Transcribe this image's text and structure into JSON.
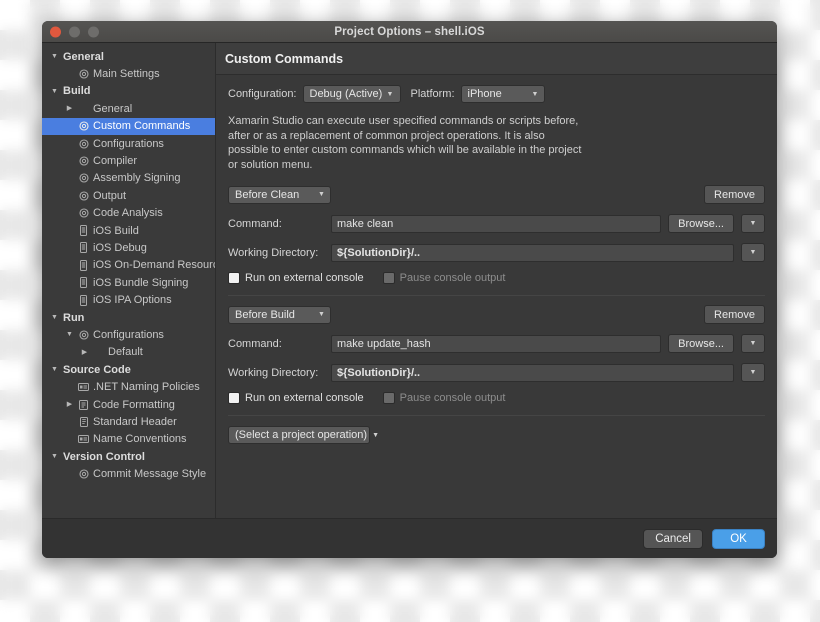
{
  "window": {
    "title": "Project Options – shell.iOS",
    "traffic_lights": [
      "close-button",
      "minimize-button",
      "zoom-button"
    ]
  },
  "sidebar": {
    "items": [
      {
        "label": "General",
        "level": 0,
        "type": "group",
        "disclosure": "down",
        "icon": "none",
        "selected": false
      },
      {
        "label": "Main Settings",
        "level": 1,
        "type": "item",
        "disclosure": "none",
        "icon": "gear",
        "selected": false
      },
      {
        "label": "Build",
        "level": 0,
        "type": "group",
        "disclosure": "down",
        "icon": "none",
        "selected": false
      },
      {
        "label": "General",
        "level": 1,
        "type": "item",
        "disclosure": "right",
        "icon": "none",
        "selected": false
      },
      {
        "label": "Custom Commands",
        "level": 1,
        "type": "item",
        "disclosure": "none",
        "icon": "gear",
        "selected": true
      },
      {
        "label": "Configurations",
        "level": 1,
        "type": "item",
        "disclosure": "none",
        "icon": "gear",
        "selected": false
      },
      {
        "label": "Compiler",
        "level": 1,
        "type": "item",
        "disclosure": "none",
        "icon": "gear",
        "selected": false
      },
      {
        "label": "Assembly Signing",
        "level": 1,
        "type": "item",
        "disclosure": "none",
        "icon": "gear",
        "selected": false
      },
      {
        "label": "Output",
        "level": 1,
        "type": "item",
        "disclosure": "none",
        "icon": "gear",
        "selected": false
      },
      {
        "label": "Code Analysis",
        "level": 1,
        "type": "item",
        "disclosure": "none",
        "icon": "gear",
        "selected": false
      },
      {
        "label": "iOS Build",
        "level": 1,
        "type": "item",
        "disclosure": "none",
        "icon": "device",
        "selected": false
      },
      {
        "label": "iOS Debug",
        "level": 1,
        "type": "item",
        "disclosure": "none",
        "icon": "device",
        "selected": false
      },
      {
        "label": "iOS On-Demand Resources",
        "level": 1,
        "type": "item",
        "disclosure": "none",
        "icon": "device",
        "selected": false
      },
      {
        "label": "iOS Bundle Signing",
        "level": 1,
        "type": "item",
        "disclosure": "none",
        "icon": "device",
        "selected": false
      },
      {
        "label": "iOS IPA Options",
        "level": 1,
        "type": "item",
        "disclosure": "none",
        "icon": "device",
        "selected": false
      },
      {
        "label": "Run",
        "level": 0,
        "type": "group",
        "disclosure": "down",
        "icon": "none",
        "selected": false
      },
      {
        "label": "Configurations",
        "level": 1,
        "type": "item",
        "disclosure": "down",
        "icon": "gear",
        "selected": false
      },
      {
        "label": "Default",
        "level": 2,
        "type": "item",
        "disclosure": "right-solid",
        "icon": "none",
        "selected": false
      },
      {
        "label": "Source Code",
        "level": 0,
        "type": "group",
        "disclosure": "down",
        "icon": "none",
        "selected": false
      },
      {
        "label": ".NET Naming Policies",
        "level": 1,
        "type": "item",
        "disclosure": "none",
        "icon": "card",
        "selected": false
      },
      {
        "label": "Code Formatting",
        "level": 1,
        "type": "item",
        "disclosure": "right",
        "icon": "page",
        "selected": false
      },
      {
        "label": "Standard Header",
        "level": 1,
        "type": "item",
        "disclosure": "none",
        "icon": "doc",
        "selected": false
      },
      {
        "label": "Name Conventions",
        "level": 1,
        "type": "item",
        "disclosure": "none",
        "icon": "card",
        "selected": false
      },
      {
        "label": "Version Control",
        "level": 0,
        "type": "group",
        "disclosure": "down",
        "icon": "none",
        "selected": false
      },
      {
        "label": "Commit Message Style",
        "level": 1,
        "type": "item",
        "disclosure": "none",
        "icon": "gear",
        "selected": false
      }
    ]
  },
  "main": {
    "pane_title": "Custom Commands",
    "configuration_label": "Configuration:",
    "configuration_value": "Debug (Active)",
    "platform_label": "Platform:",
    "platform_value": "iPhone",
    "description": "Xamarin Studio can execute user specified commands or scripts before, after or as a replacement of common project operations. It is also possible to enter custom commands which will be available in the project or solution menu.",
    "command_label": "Command:",
    "working_directory_label": "Working Directory:",
    "browse_label": "Browse...",
    "remove_label": "Remove",
    "run_external_label": "Run on external console",
    "pause_console_label": "Pause console output",
    "blocks": [
      {
        "stage": "Before Clean",
        "command": "make clean",
        "working_directory": "${SolutionDir}/..",
        "run_on_external_console": false,
        "pause_console_output": false,
        "pause_disabled": true
      },
      {
        "stage": "Before Build",
        "command": "make update_hash",
        "working_directory": "${SolutionDir}/..",
        "run_on_external_console": false,
        "pause_console_output": false,
        "pause_disabled": true
      }
    ],
    "add_operation_placeholder": "(Select a project operation)"
  },
  "footer": {
    "cancel_label": "Cancel",
    "ok_label": "OK"
  },
  "colors": {
    "accent_selection": "#4a7ee0",
    "accent_ok_button": "#4a9fe8",
    "window_background": "#393939",
    "sidebar_background": "#3a3a3a",
    "close_light": "#e0583e"
  }
}
